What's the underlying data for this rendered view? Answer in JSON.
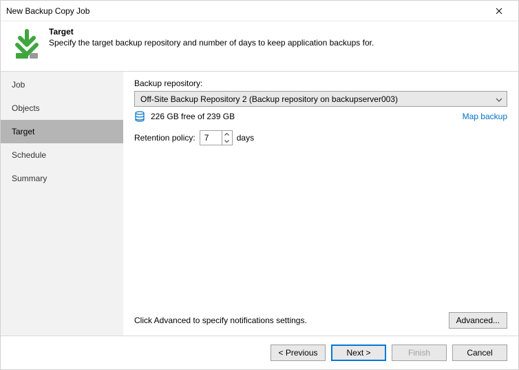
{
  "window": {
    "title": "New Backup Copy Job"
  },
  "header": {
    "title": "Target",
    "description": "Specify the target backup repository and number of days to keep application backups for."
  },
  "sidebar": {
    "items": [
      {
        "label": "Job"
      },
      {
        "label": "Objects"
      },
      {
        "label": "Target"
      },
      {
        "label": "Schedule"
      },
      {
        "label": "Summary"
      }
    ],
    "selectedIndex": 2
  },
  "main": {
    "repo_label": "Backup repository:",
    "repo_selected": "Off-Site Backup Repository 2 (Backup repository on backupserver003)",
    "free_text": "226 GB free of 239 GB",
    "map_backup": "Map backup",
    "retention_label": "Retention policy:",
    "retention_value": "7",
    "retention_unit": "days",
    "advanced_hint": "Click Advanced to specify notifications settings.",
    "advanced_btn": "Advanced..."
  },
  "footer": {
    "previous": "< Previous",
    "next": "Next >",
    "finish": "Finish",
    "cancel": "Cancel"
  }
}
